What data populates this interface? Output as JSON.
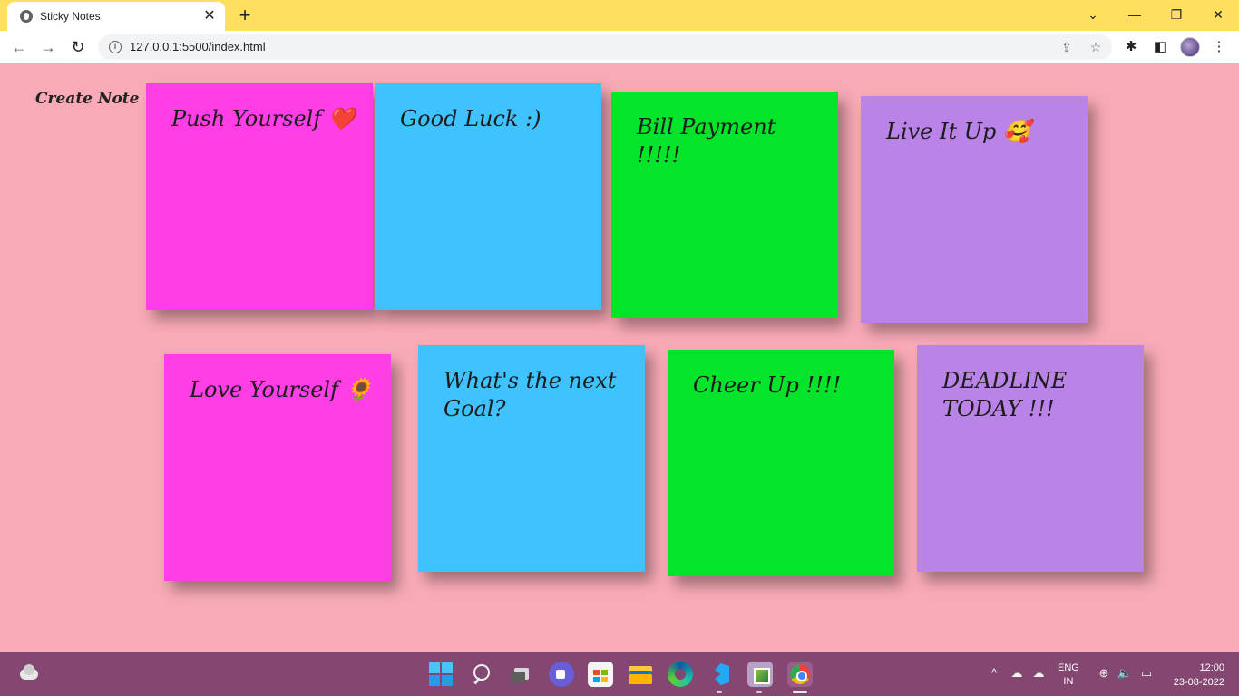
{
  "browser": {
    "tab_title": "Sticky Notes",
    "tab_close": "✕",
    "new_tab": "+",
    "url": "127.0.0.1:5500/index.html",
    "window_controls": {
      "dropdown": "⌄",
      "minimize": "—",
      "restore": "❐",
      "close": "✕"
    },
    "nav": {
      "back": "←",
      "forward": "→",
      "reload": "↻"
    },
    "info_icon": "i",
    "share_icon": "⇪",
    "bookmark_icon": "☆",
    "extensions_icon": "✱",
    "sidepanel_icon": "◧",
    "menu_icon": "⋮",
    "chrome_color": "#fedf5f"
  },
  "page": {
    "background": "#f8aab6",
    "create_note_label": "Create Note"
  },
  "notes": [
    {
      "text": "Push Yourself ❤️",
      "color": "#ff3ee6"
    },
    {
      "text": "Good Luck :)",
      "color": "#3fc2fe"
    },
    {
      "text": "Bill Payment !!!!!",
      "color": "#04e42a"
    },
    {
      "text": "Live It Up 🥰",
      "color": "#b983e8"
    },
    {
      "text": "Love Yourself 🌻",
      "color": "#ff3ee6"
    },
    {
      "text": "What's the next Goal?",
      "color": "#3fc2fe"
    },
    {
      "text": "Cheer Up !!!!",
      "color": "#04e42a"
    },
    {
      "text": "DEADLINE TODAY !!!",
      "color": "#b983e8"
    }
  ],
  "taskbar": {
    "background": "#834771",
    "apps": [
      "start-icon",
      "search-icon",
      "task-view-icon",
      "meet-icon",
      "store-icon",
      "file-explorer-icon",
      "edge-icon",
      "vscode-icon",
      "photos-icon",
      "chrome-icon"
    ],
    "tray": {
      "chevron": "^",
      "network": "☁",
      "cloud": "☁",
      "lang_line1": "ENG",
      "lang_line2": "IN",
      "globe": "⊕",
      "volume": "🔈",
      "battery": "▭"
    },
    "clock_time": "12:00",
    "clock_date": "23-08-2022"
  }
}
